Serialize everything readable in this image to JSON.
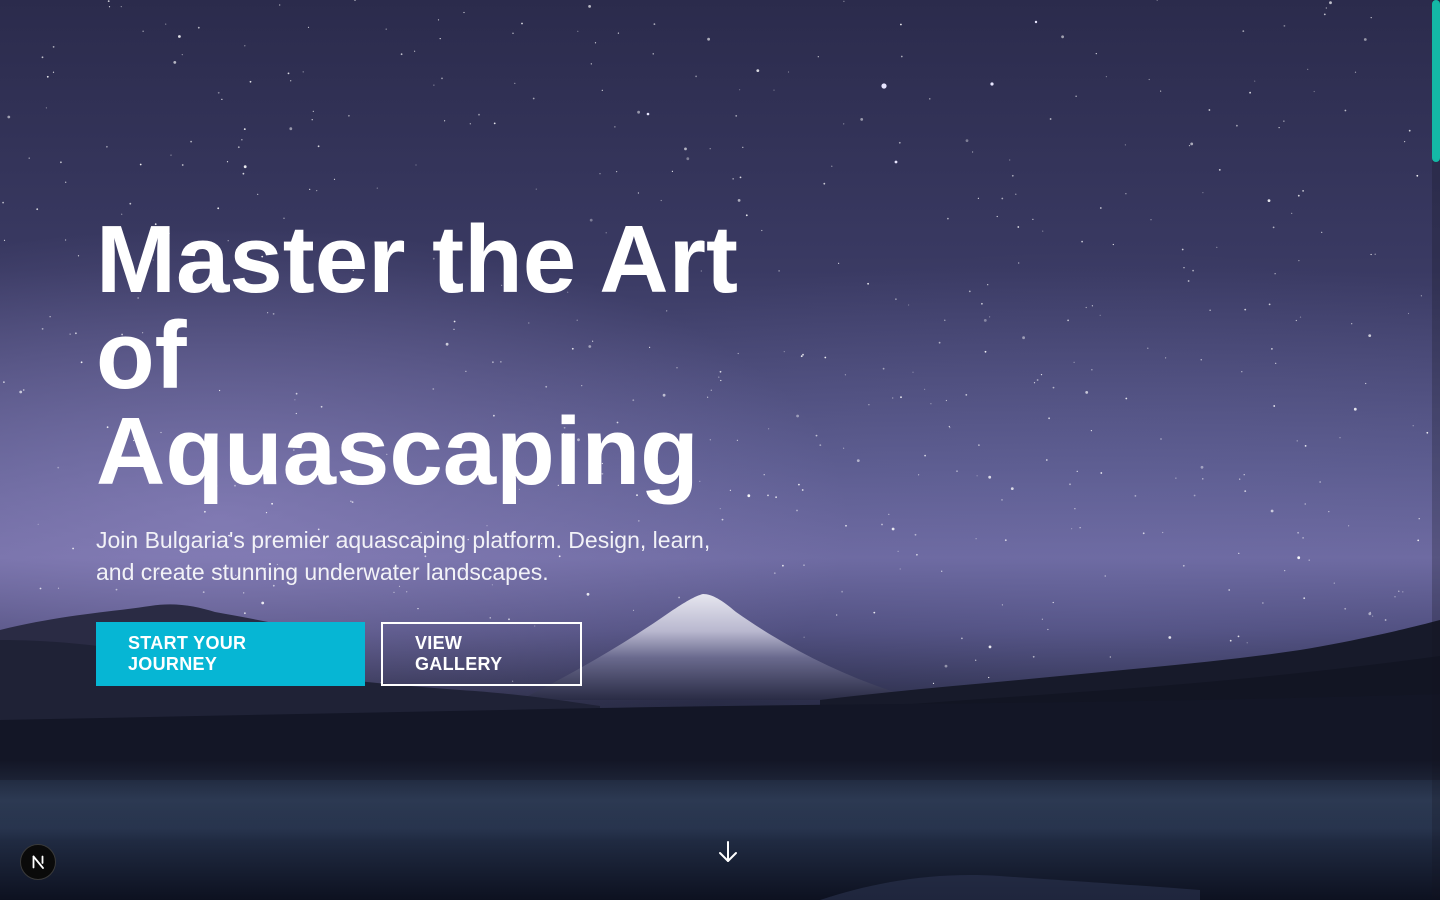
{
  "hero": {
    "headline_line1": "Master the Art",
    "headline_line2": "of",
    "headline_line3": "Aquascaping",
    "subtext": "Join Bulgaria's premier aquascaping platform. Design, learn, and create stunning underwater landscapes.",
    "primary_button": "START YOUR JOURNEY",
    "secondary_button": "VIEW GALLERY",
    "scroll_icon": "arrow-down-icon"
  },
  "dev_badge": {
    "label": "N",
    "icon": "nextjs-logo-icon"
  },
  "colors": {
    "accent": "#06b6d4",
    "scrollbar_thumb": "#14b8a6",
    "text": "#ffffff"
  }
}
